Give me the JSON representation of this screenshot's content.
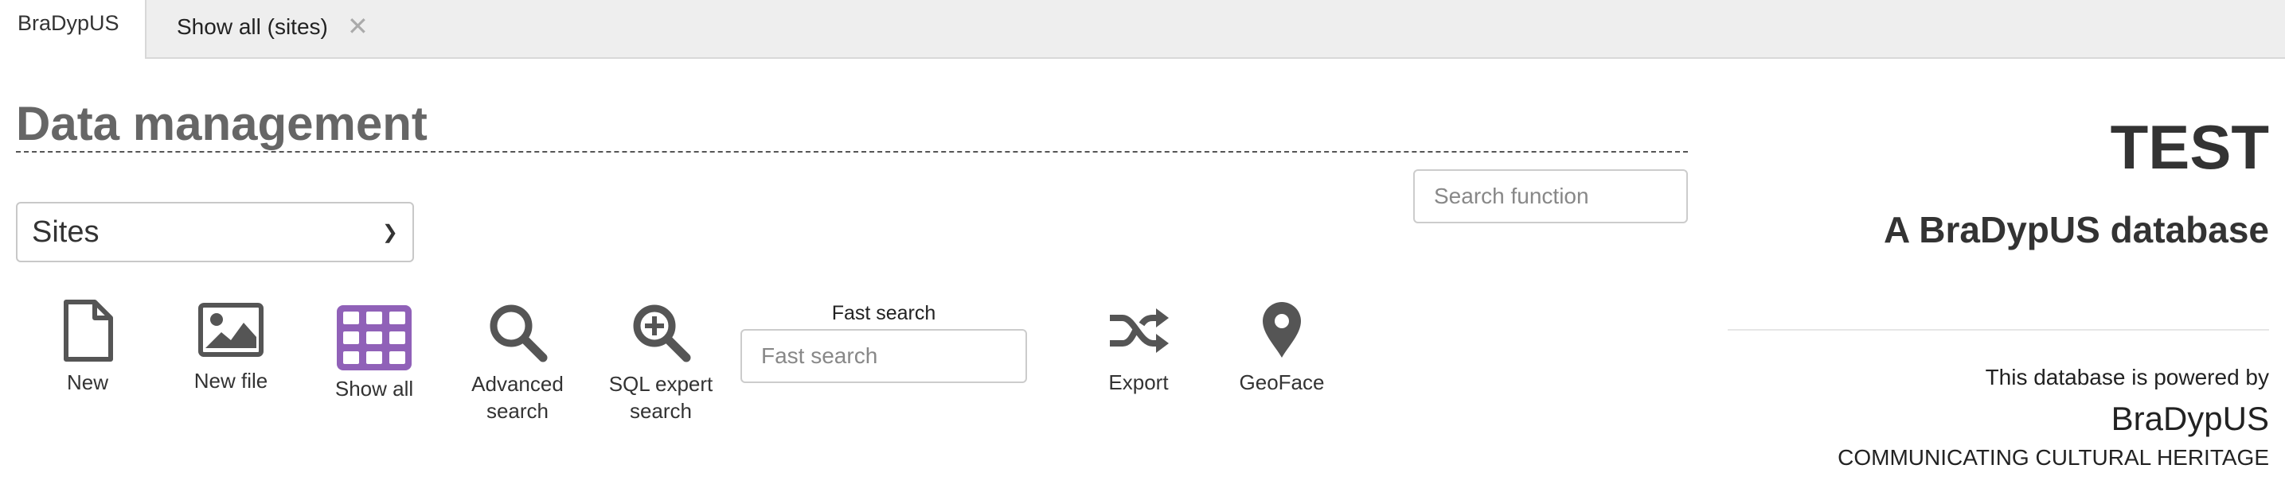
{
  "tabs": {
    "home": "BraDypUS",
    "active_tab": "Show all (sites)",
    "close_glyph": "✕"
  },
  "main": {
    "title": "Data management",
    "search_function": {
      "placeholder": "Search function",
      "value": ""
    },
    "table_select": {
      "value": "Sites"
    },
    "fast_search": {
      "label": "Fast search",
      "placeholder": "Fast search",
      "value": ""
    },
    "tools": {
      "new": "New",
      "new_file": "New file",
      "show_all": "Show all",
      "advanced_search_1": "Advanced",
      "advanced_search_2": "search",
      "sql_search_1": "SQL expert",
      "sql_search_2": "search",
      "export": "Export",
      "geoface": "GeoFace"
    },
    "icons": {
      "new": "file-icon",
      "new_file": "image-icon",
      "show_all": "table-grid-icon",
      "advanced_search": "search-icon",
      "sql_search": "zoom-in-icon",
      "export": "random-icon",
      "geoface": "map-marker-icon"
    },
    "colors": {
      "icon": "#555555",
      "show_all_icon": "#9061b8"
    }
  },
  "info": {
    "db_name": "TEST",
    "subtitle": "A BraDypUS database",
    "powered_by": "This database is powered by",
    "brand": "BraDypUS",
    "tagline": "COMMUNICATING CULTURAL HERITAGE"
  }
}
